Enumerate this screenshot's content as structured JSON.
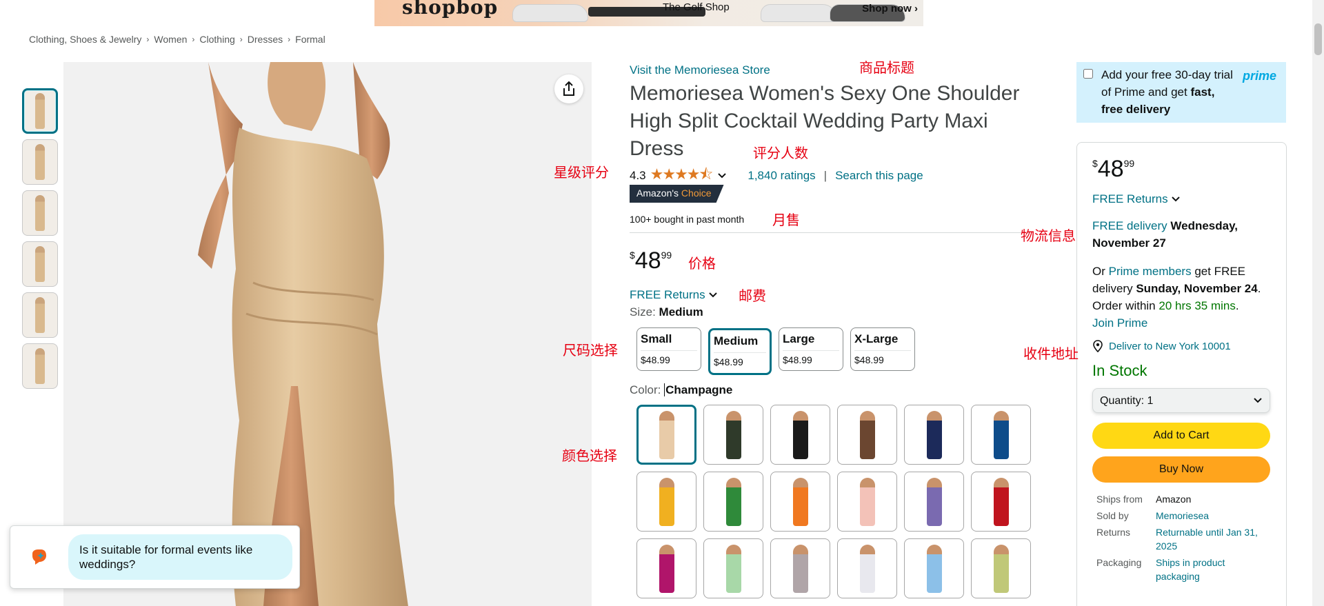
{
  "banner": {
    "brand": "shopbop",
    "golf": "The Golf Shop",
    "shop_now": "Shop now ›"
  },
  "breadcrumb": [
    "Clothing, Shoes & Jewelry",
    "Women",
    "Clothing",
    "Dresses",
    "Formal"
  ],
  "store_link": "Visit the Memoriesea Store",
  "product_title": "Memoriesea Women's Sexy One Shoulder High Split Cocktail Wedding Party Maxi Dress",
  "rating": {
    "value": "4.3",
    "stars": "★★★★⯪",
    "count_text": "1,840 ratings",
    "separator": "|",
    "search_text": "Search this page"
  },
  "badge": {
    "prefix": "Amazon's",
    "suffix": "Choice"
  },
  "bought_text": "100+ bought in past month",
  "price": {
    "currency": "$",
    "whole": "48",
    "fraction": "99"
  },
  "returns_text": "FREE Returns",
  "size": {
    "label": "Size:",
    "selected": "Medium",
    "options": [
      {
        "name": "Small",
        "price": "$48.99"
      },
      {
        "name": "Medium",
        "price": "$48.99"
      },
      {
        "name": "Large",
        "price": "$48.99"
      },
      {
        "name": "X-Large",
        "price": "$48.99"
      }
    ]
  },
  "color": {
    "label": "Color:",
    "selected": "Champagne",
    "swatch_colors": [
      "#e8cba8",
      "#2f3a2a",
      "#1a1a1a",
      "#6b4630",
      "#1c2a5a",
      "#0e4c8a",
      "#f0b020",
      "#2f8a3a",
      "#f07820",
      "#f3c2b8",
      "#7a6ab0",
      "#c0141e",
      "#b0156a",
      "#a8d8a8",
      "#b0a5a8",
      "#e8e8ee",
      "#8cc0e8",
      "#c0c878"
    ]
  },
  "chat": {
    "question": "Is it suitable for formal events like weddings?"
  },
  "prime": {
    "line1": "Add your free 30-day trial of Prime and get",
    "bold": "fast, free delivery",
    "logo": "prime"
  },
  "buybox": {
    "currency": "$",
    "whole": "48",
    "fraction": "99",
    "returns": "FREE Returns",
    "free_delivery_link": "FREE delivery",
    "delivery_date": "Wednesday, November 27",
    "or_text": "Or",
    "prime_members": "Prime members",
    "get_free": "get FREE delivery",
    "fast_date": "Sunday, November 24",
    "order_within": "Order within",
    "countdown": "20 hrs 35 mins",
    "join_prime": "Join Prime",
    "deliver_to": "Deliver to New York 10001",
    "stock": "In Stock",
    "quantity_label": "Quantity:",
    "quantity_value": "1",
    "add_to_cart": "Add to Cart",
    "buy_now": "Buy Now",
    "info": [
      {
        "k": "Ships from",
        "v": "Amazon"
      },
      {
        "k": "Sold by",
        "v": "Memoriesea"
      },
      {
        "k": "Returns",
        "v": "Returnable until Jan 31, 2025"
      },
      {
        "k": "Packaging",
        "v": "Ships in product packaging"
      }
    ]
  },
  "annotations": {
    "title": "商品标题",
    "reviews_count": "评分人数",
    "star_rating": "星级评分",
    "monthly_sales": "月售",
    "price": "价格",
    "shipping": "邮费",
    "size_select": "尺码选择",
    "color_select": "颜色选择",
    "logistics": "物流信息",
    "address": "收件地址"
  },
  "colors": {
    "link": "#007185",
    "green": "#007600",
    "cart": "#ffd814",
    "buy": "#ffa41c",
    "annotation": "#e60012"
  }
}
